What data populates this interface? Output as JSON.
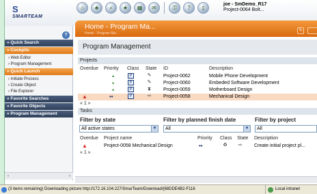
{
  "app": {
    "logo_text": "SMARTEAM",
    "logo_mark": "S"
  },
  "toolbar_icons": [
    "home-icon",
    "tree-icon",
    "search-icon",
    "favorites-icon",
    "calendar-icon",
    "inbox-icon",
    "lock-icon",
    "help-icon",
    "exit-icon"
  ],
  "user": {
    "line1": "joe - SmDemo_R17",
    "line2": "Project-0064 Bolt..."
  },
  "sidebar": {
    "sections": [
      {
        "label": "» Quick Search",
        "style": "dark"
      },
      {
        "label": "» Cockpits",
        "style": "orange"
      },
      {
        "label": "» Quick Launch",
        "style": "orange"
      },
      {
        "label": "» Favorite Searches",
        "style": "dark"
      },
      {
        "label": "» Favorite Objects",
        "style": "dark"
      },
      {
        "label": "» Program Management",
        "style": "dark"
      }
    ],
    "cockpit_items": [
      "› Web Editor",
      "› Program Management"
    ],
    "launch_items": [
      "› Initiate Process",
      "› Create Object",
      "› File Explorer"
    ]
  },
  "header": {
    "title": "Home - Program Ma...",
    "crumb": "Home - Program Ma..."
  },
  "page_title": "Program Management",
  "projects": {
    "label": "Projects",
    "columns": [
      "Overdue",
      "Priority",
      "Class",
      "State",
      "ID",
      "Description"
    ],
    "rows": [
      {
        "overdue": "",
        "priority": "•",
        "state": "✎",
        "id": "Project-0062",
        "description": "Mobile Phone Development",
        "selected": false
      },
      {
        "overdue": "",
        "priority": "•",
        "state": "✎",
        "id": "Project-0060",
        "description": "Embeded Software Development",
        "selected": false
      },
      {
        "overdue": "",
        "priority": "•",
        "state": "⧗",
        "id": "Project-0059",
        "description": "Motherboard Design",
        "selected": false
      },
      {
        "overdue": "▲",
        "priority": "••",
        "state": "⇨",
        "id": "Project-0058",
        "description": "Mechanical Design",
        "selected": true
      }
    ],
    "pager": "« 1 »"
  },
  "tasks": {
    "label": "Tasks",
    "filters": [
      {
        "heading": "Filter by state",
        "value": "All active states"
      },
      {
        "heading": "Filter by planned finish date",
        "value": "All"
      },
      {
        "heading": "Filter by project",
        "value": "All"
      }
    ],
    "columns": [
      "Overdue",
      "Project name",
      "Priority",
      "Class",
      "State",
      "Description"
    ],
    "rows": [
      {
        "overdue": "▲",
        "project": "Project-0058 Mechanical Design",
        "priority": "••",
        "state": "⇨",
        "description": "Create initial project pl..."
      }
    ],
    "pager": "« 1 »"
  },
  "statusbar": {
    "message": "(3 items remaining) Downloading picture http://172.16.104.227/SmarTeam/Download/{68DDE4B2-F116",
    "zone": "Local intranet"
  }
}
